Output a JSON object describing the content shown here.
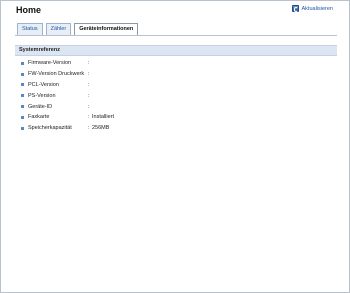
{
  "header": {
    "title": "Home",
    "refresh_label": "Aktualisieren"
  },
  "tabs": [
    {
      "label": "Status",
      "active": false
    },
    {
      "label": "Zähler",
      "active": false
    },
    {
      "label": "Geräteinformationen",
      "active": true
    }
  ],
  "section": {
    "title": "Systemreferenz",
    "rows": [
      {
        "label": "Firmware-Version",
        "value": ""
      },
      {
        "label": "FW-Version Druckwerk",
        "value": ""
      },
      {
        "label": "PCL-Version",
        "value": ""
      },
      {
        "label": "PS-Version",
        "value": ""
      },
      {
        "label": "Geräte-ID",
        "value": ""
      },
      {
        "label": "Faxkarte",
        "value": "Installiert"
      },
      {
        "label": "Speicherkapazität",
        "value": "256MB"
      }
    ]
  }
}
